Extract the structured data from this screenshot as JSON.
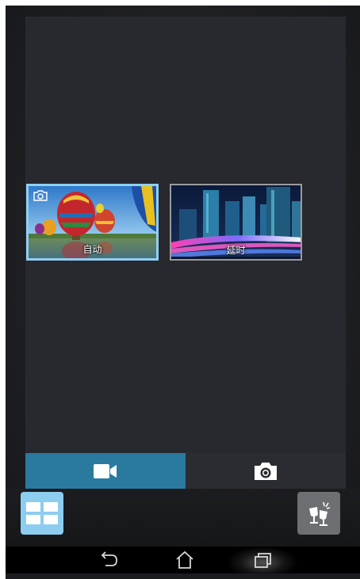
{
  "camera_modes": [
    {
      "label": "自动",
      "selected": true,
      "icon": "camera-icon"
    },
    {
      "label": "延时",
      "selected": false
    }
  ],
  "capture_tabs": [
    {
      "name": "video",
      "icon": "video-camera-icon",
      "selected": true
    },
    {
      "name": "photo",
      "icon": "camera-icon",
      "selected": false
    }
  ],
  "bottom_buttons": {
    "left_icon": "grid-icon",
    "right_icon": "effects-icon"
  },
  "nav_bar": [
    "back-icon",
    "home-icon",
    "recent-apps-icon"
  ],
  "colors": {
    "accent": "#2a7aa0",
    "selection_border": "#8fd0f2",
    "grid_button": "#8ccdf0",
    "effects_button": "#6e6f73",
    "background": "#28292e"
  }
}
